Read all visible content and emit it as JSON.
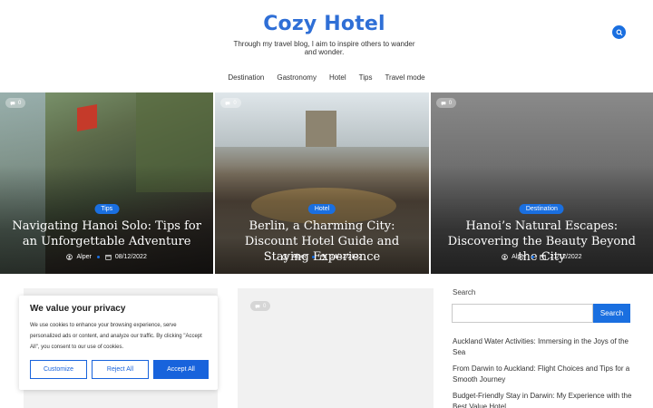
{
  "header": {
    "title": "Cozy Hotel",
    "tagline": "Through my travel blog, I aim to inspire others to wander and wonder."
  },
  "nav": {
    "items": [
      "Destination",
      "Gastronomy",
      "Hotel",
      "Tips",
      "Travel mode"
    ]
  },
  "featured": [
    {
      "comments": "0",
      "category": "Tips",
      "title": "Navigating Hanoi Solo: Tips for an Unforgettable Adventure",
      "author": "Alper",
      "date": "08/12/2022"
    },
    {
      "comments": "0",
      "category": "Hotel",
      "title": "Berlin, a Charming City: Discount Hotel Guide and Staying Experience",
      "author": "Alper",
      "date": "14/12/2022"
    },
    {
      "comments": "0",
      "category": "Destination",
      "title": "Hanoi’s Natural Escapes: Discovering the Beauty Beyond the City",
      "author": "Alper",
      "date": "21/12/2022"
    }
  ],
  "post_card": {
    "comments": "0"
  },
  "cookie": {
    "title": "We value your privacy",
    "text": "We use cookies to enhance your browsing experience, serve personalized ads or content, and analyze our traffic. By clicking \"Accept All\", you consent to our use of cookies.",
    "customize": "Customize",
    "reject": "Reject All",
    "accept": "Accept All"
  },
  "sidebar": {
    "search_label": "Search",
    "search_button": "Search",
    "recent_posts": [
      "Auckland Water Activities: Immersing in the Joys of the Sea",
      "From Darwin to Auckland: Flight Choices and Tips for a Smooth Journey",
      "Budget-Friendly Stay in Darwin: My Experience with the Best Value Hotel"
    ]
  },
  "colors": {
    "accent": "#1a6fe0",
    "title": "#2f6fd6"
  },
  "icons": {
    "search": "search-icon",
    "comment": "comment-icon",
    "user": "user-icon",
    "calendar": "calendar-icon"
  }
}
